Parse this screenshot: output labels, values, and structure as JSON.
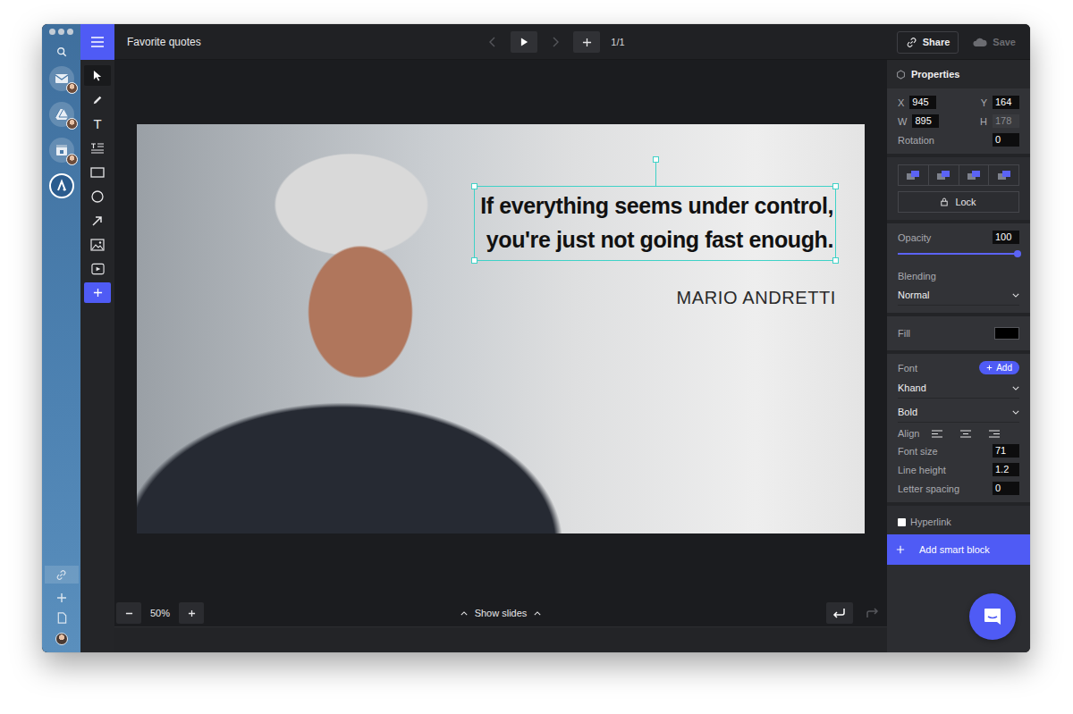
{
  "window": {
    "title": "Favorite quotes"
  },
  "app_sidebar": {
    "apps": [
      {
        "kind": "mail",
        "selected": false
      },
      {
        "kind": "drive",
        "selected": false
      },
      {
        "kind": "calendar",
        "selected": false
      },
      {
        "kind": "editor",
        "selected": true
      }
    ]
  },
  "tools": [
    {
      "kind": "select",
      "glyph": "",
      "selected": true
    },
    {
      "kind": "pen",
      "glyph": "",
      "selected": false
    },
    {
      "kind": "text",
      "glyph": "T",
      "selected": false
    },
    {
      "kind": "paragraph",
      "glyph": "",
      "selected": false
    },
    {
      "kind": "rectangle",
      "glyph": "",
      "selected": false
    },
    {
      "kind": "circle",
      "glyph": "",
      "selected": false
    },
    {
      "kind": "arrow",
      "glyph": "",
      "selected": false
    },
    {
      "kind": "image",
      "glyph": "",
      "selected": false
    },
    {
      "kind": "video",
      "glyph": "",
      "selected": false
    },
    {
      "kind": "add",
      "glyph": "",
      "selected": false
    }
  ],
  "toolbar": {
    "page": "1/1",
    "share": "Share",
    "save": "Save",
    "save_disabled": true
  },
  "slide": {
    "quote": [
      "If everything seems under control,",
      "you're just not going fast enough."
    ],
    "author": "MARIO ANDRETTI",
    "quote_selected": true
  },
  "properties": {
    "title": "Properties",
    "geometry": [
      {
        "label": "X",
        "value": "945",
        "disabled": false
      },
      {
        "label": "Y",
        "value": "164",
        "disabled": false
      },
      {
        "label": "W",
        "value": "895",
        "disabled": false
      },
      {
        "label": "H",
        "value": "178",
        "disabled": true
      }
    ],
    "rotation": {
      "label": "Rotation",
      "value": "0"
    },
    "lock": "Lock",
    "opacity": {
      "label": "Opacity",
      "value": "100",
      "level": 1
    },
    "blending": {
      "label": "Blending",
      "value": "Normal"
    },
    "fill": {
      "label": "Fill",
      "color": "#000000"
    },
    "font": {
      "label": "Font",
      "add": "Add",
      "family": "Khand",
      "weight": "Bold"
    },
    "align": {
      "label": "Align",
      "options": [
        {
          "kind": "left",
          "selected": false
        },
        {
          "kind": "center",
          "selected": false
        },
        {
          "kind": "right",
          "selected": false
        }
      ]
    },
    "metrics": [
      {
        "label": "Font size",
        "value": "71"
      },
      {
        "label": "Line height",
        "value": "1.2"
      },
      {
        "label": "Letter spacing",
        "value": "0"
      }
    ],
    "hyperlink": {
      "label": "Hyperlink",
      "checked": false
    },
    "smart_block": "Add smart block"
  },
  "canvas_footer": {
    "zoom": "50%",
    "slides": "Show slides"
  }
}
